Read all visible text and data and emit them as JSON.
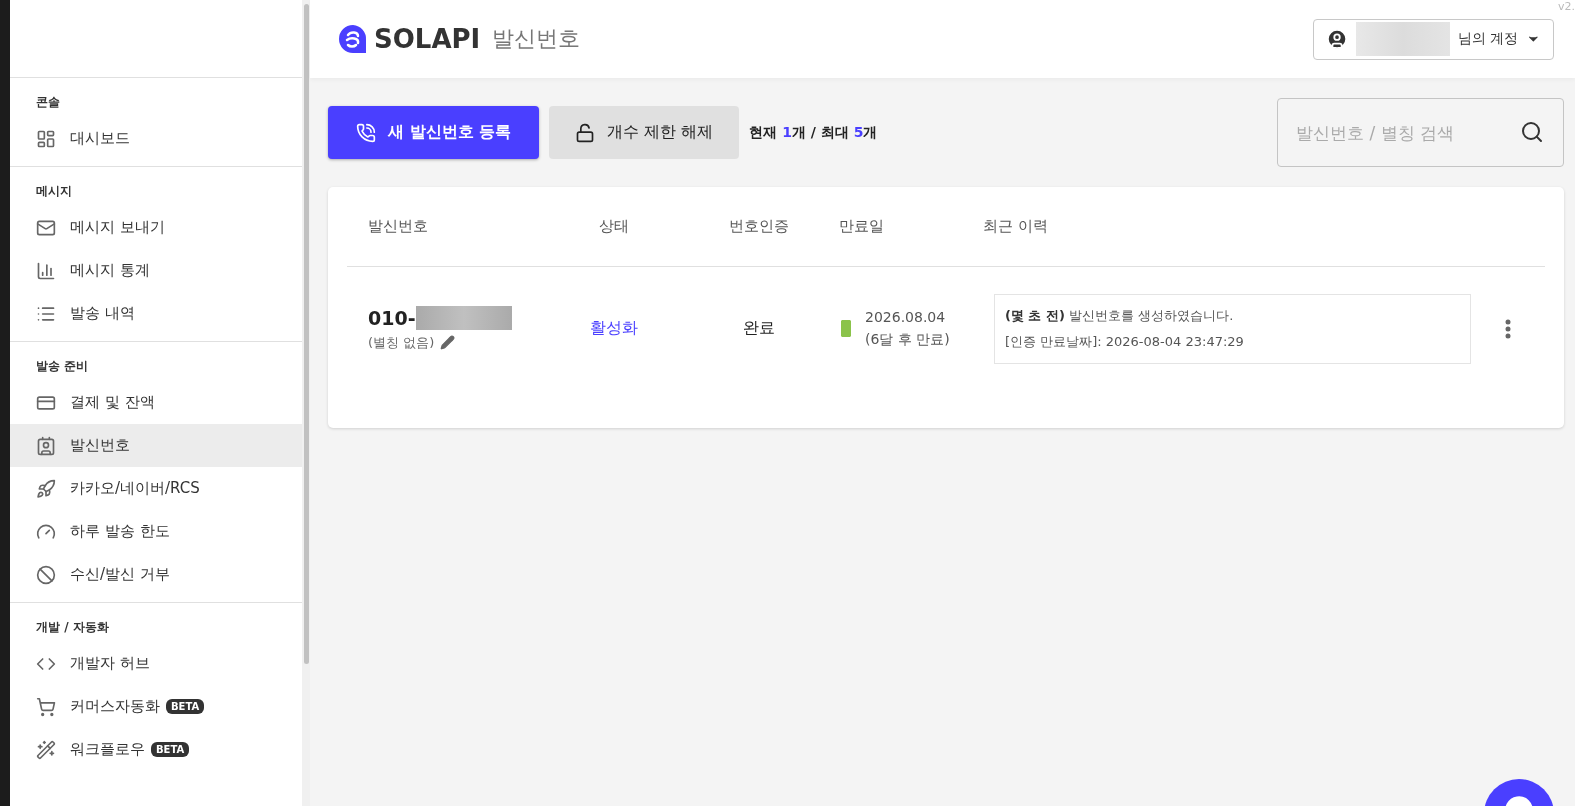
{
  "version": "v2.",
  "header": {
    "brand": "SOLAPI",
    "page_title": "발신번호",
    "account": "님의 계정"
  },
  "sidebar": {
    "sections": [
      {
        "title": "콘솔",
        "items": [
          {
            "label": "대시보드",
            "selected": false
          }
        ]
      },
      {
        "title": "메시지",
        "items": [
          {
            "label": "메시지 보내기",
            "selected": false
          },
          {
            "label": "메시지 통계",
            "selected": false
          },
          {
            "label": "발송 내역",
            "selected": false
          }
        ]
      },
      {
        "title": "발송 준비",
        "items": [
          {
            "label": "결제 및 잔액",
            "selected": false
          },
          {
            "label": "발신번호",
            "selected": true
          },
          {
            "label": "카카오/네이버/RCS",
            "selected": false
          },
          {
            "label": "하루 발송 한도",
            "selected": false
          },
          {
            "label": "수신/발신 거부",
            "selected": false
          }
        ]
      },
      {
        "title": "개발 / 자동화",
        "items": [
          {
            "label": "개발자 허브",
            "selected": false
          },
          {
            "label": "커머스자동화",
            "selected": false,
            "badge": "BETA"
          },
          {
            "label": "워크플로우",
            "selected": false,
            "badge": "BETA"
          }
        ]
      }
    ]
  },
  "toolbar": {
    "register_button": "새 발신번호 등록",
    "unlock_button": "개수 제한 해제",
    "count": "현재 **1**개 / 최대 **5**개",
    "search": {
      "placeholder": "발신번호 / 별칭 검색"
    }
  },
  "table": {
    "columns": [
      "발신번호",
      "상태",
      "번호인증",
      "만료일",
      "최근 이력"
    ],
    "rows": [
      {
        "number": "010-",
        "alias": "(별칭 없음)",
        "status": "활성화",
        "verification": "완료",
        "expiry_date": "2026.08.04",
        "expiry_note": "(6달 후 만료)",
        "level": 1,
        "history": [
          "**(몇 초 전)** 발신번호를 생성하였습니다.",
          "[인증 만료날짜]: 2026-08-04 23:47:29"
        ]
      }
    ]
  }
}
